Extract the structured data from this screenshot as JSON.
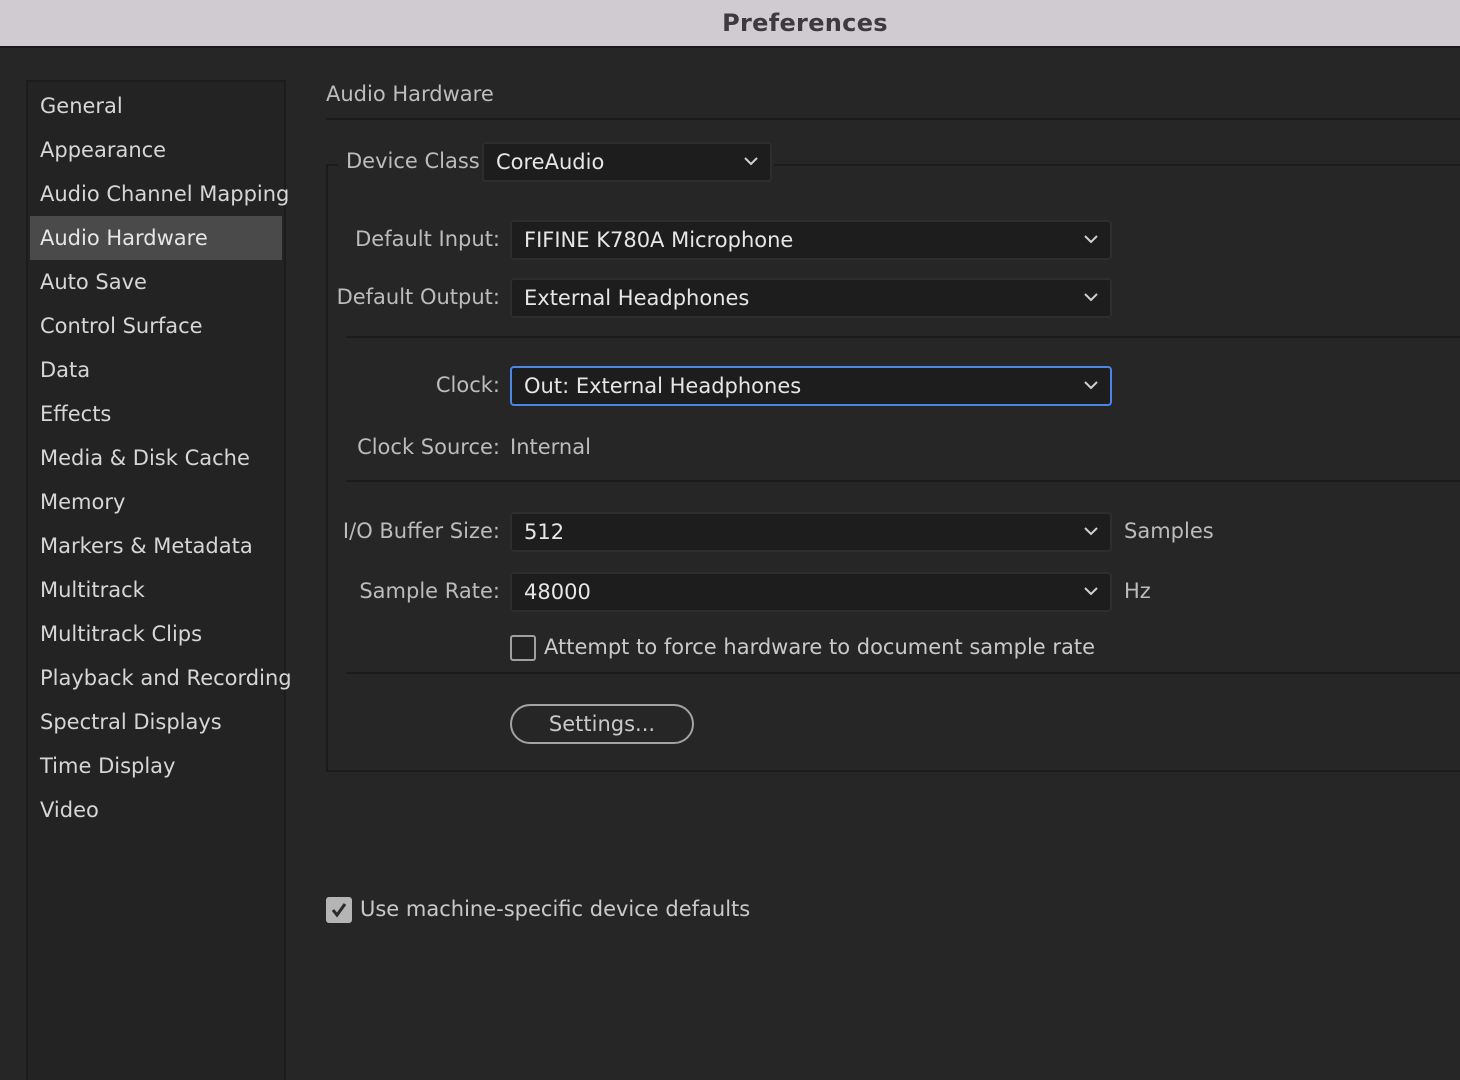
{
  "window": {
    "title": "Preferences"
  },
  "sidebar": {
    "items": [
      {
        "label": "General"
      },
      {
        "label": "Appearance"
      },
      {
        "label": "Audio Channel Mapping"
      },
      {
        "label": "Audio Hardware",
        "selected": true
      },
      {
        "label": "Auto Save"
      },
      {
        "label": "Control Surface"
      },
      {
        "label": "Data"
      },
      {
        "label": "Effects"
      },
      {
        "label": "Media & Disk Cache"
      },
      {
        "label": "Memory"
      },
      {
        "label": "Markers & Metadata"
      },
      {
        "label": "Multitrack"
      },
      {
        "label": "Multitrack Clips"
      },
      {
        "label": "Playback and Recording"
      },
      {
        "label": "Spectral Displays"
      },
      {
        "label": "Time Display"
      },
      {
        "label": "Video"
      }
    ]
  },
  "panel": {
    "title": "Audio Hardware",
    "device_class": {
      "label": "Device Class:",
      "value": "CoreAudio"
    },
    "default_input": {
      "label": "Default Input:",
      "value": "FIFINE K780A Microphone"
    },
    "default_output": {
      "label": "Default Output:",
      "value": "External Headphones"
    },
    "clock": {
      "label": "Clock:",
      "value": "Out: External Headphones"
    },
    "clock_source": {
      "label": "Clock Source:",
      "value": "Internal"
    },
    "buffer_size": {
      "label": "I/O Buffer Size:",
      "value": "512",
      "unit": "Samples"
    },
    "sample_rate": {
      "label": "Sample Rate:",
      "value": "48000",
      "unit": "Hz"
    },
    "force_rate": {
      "label": "Attempt to force hardware to document sample rate",
      "checked": false
    },
    "settings_button": {
      "label": "Settings..."
    },
    "machine_defaults": {
      "label": "Use machine-specific device defaults",
      "checked": true
    }
  },
  "colors": {
    "background": "#262626",
    "titlebar": "#d0cbd1",
    "selected_item": "#4a4a4a",
    "focus_ring": "#4a86e8"
  }
}
